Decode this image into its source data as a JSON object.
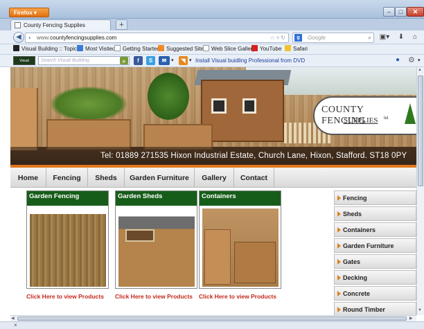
{
  "browser": {
    "app_button": "Firefox",
    "tab_title": "County Fencing Supplies",
    "new_tab": "+",
    "url_prefix": "www.",
    "url_domain": "countyfencingsupplies.com",
    "search_engine": "Google",
    "search_placeholder": "Google",
    "status_close": "×"
  },
  "bookmarks": [
    {
      "label": "Visual Building :: Topic...",
      "color": "#222"
    },
    {
      "label": "Most Visited",
      "color": "#3a7bd5"
    },
    {
      "label": "Getting Started",
      "color": "#ccc"
    },
    {
      "label": "Suggested Sites",
      "color": "#f08a24"
    },
    {
      "label": "Web Slice Gallery",
      "color": "#ccc"
    },
    {
      "label": "YouTube",
      "color": "#d42020"
    },
    {
      "label": "Safari",
      "color": "#f2c230"
    }
  ],
  "toolbar": {
    "logo_text": "Visual Building",
    "search_placeholder": "Search Visual Building",
    "install_link": "Install Visual buidling Professional from DVD"
  },
  "banner": {
    "logo_line1": "COUNTY FENCING",
    "logo_line2": "SUPPLIES",
    "logo_ltd": "ltd",
    "contact": "Tel: 01889 271535   Hixon Industrial Estate, Church Lane, Hixon, Stafford. ST18 0PY"
  },
  "nav": [
    "Home",
    "Fencing",
    "Sheds",
    "Garden Furniture",
    "Gallery",
    "Contact"
  ],
  "products": [
    {
      "title": "Garden Fencing",
      "link": "Click Here to view Products"
    },
    {
      "title": "Garden Sheds",
      "link": "Click Here to view Products"
    },
    {
      "title": "Containers",
      "link": "Click Here to view Products"
    }
  ],
  "sidebar": [
    "Fencing",
    "Sheds",
    "Containers",
    "Garden Furniture",
    "Gates",
    "Decking",
    "Concrete",
    "Round Timber"
  ],
  "colors": {
    "accent_orange": "#e2781e",
    "product_header_green": "#175d1a",
    "link_red": "#c5281a"
  }
}
